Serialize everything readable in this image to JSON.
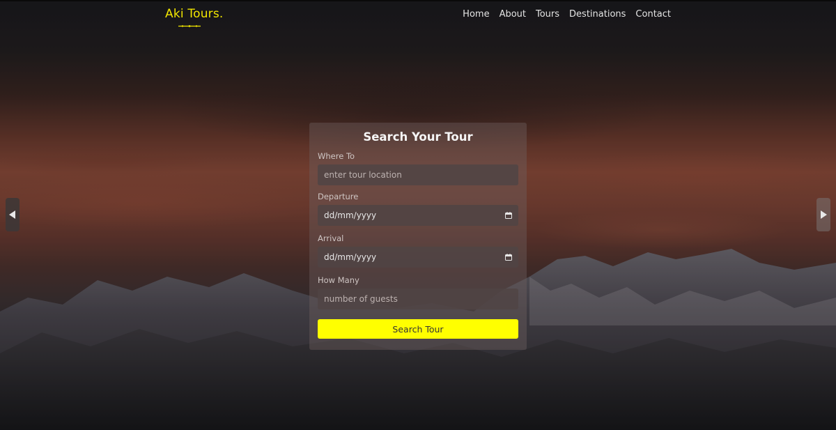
{
  "brand": {
    "name": "Aki Tours."
  },
  "nav": {
    "links": [
      "Home",
      "About",
      "Tours",
      "Destinations",
      "Contact"
    ]
  },
  "search": {
    "title": "Search Your Tour",
    "where_label": "Where To",
    "where_placeholder": "enter tour location",
    "departure_label": "Departure",
    "departure_value": "dd/mm/yyyy",
    "arrival_label": "Arrival",
    "arrival_value": "dd/mm/yyyy",
    "guests_label": "How Many",
    "guests_placeholder": "number of guests",
    "submit_label": "Search Tour"
  },
  "colors": {
    "accent": "#ffff00",
    "brand": "#f2e600"
  },
  "icons": {
    "prev": "chevron-left-icon",
    "next": "chevron-right-icon",
    "calendar": "calendar-icon"
  }
}
